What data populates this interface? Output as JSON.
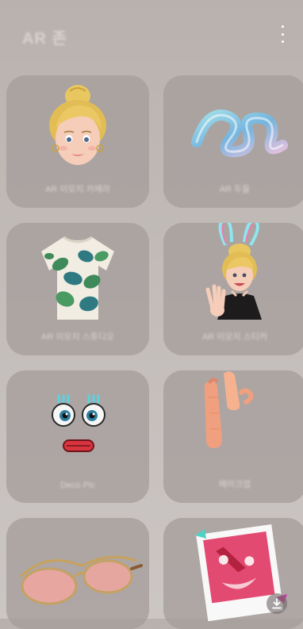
{
  "header": {
    "title": "AR 존",
    "menu_icon": "more-vertical-icon"
  },
  "cards": [
    {
      "id": "ar-emoji-camera",
      "label": "AR 이모지 카메라",
      "icon": "avatar-face"
    },
    {
      "id": "ar-doodle",
      "label": "AR 두들",
      "icon": "neon-scribble"
    },
    {
      "id": "ar-emoji-studio",
      "label": "AR 이모지 스튜디오",
      "icon": "tropical-shirt"
    },
    {
      "id": "ar-emoji-stickers",
      "label": "AR 이모지 스티커",
      "icon": "avatar-waving"
    },
    {
      "id": "deco-pic",
      "label": "Deco Pic",
      "icon": "cartoon-eyes"
    },
    {
      "id": "makeup",
      "label": "메이크업",
      "icon": "makeup-swatches"
    },
    {
      "id": "sunglasses",
      "label": "",
      "icon": "sunglasses"
    },
    {
      "id": "photo-frame",
      "label": "",
      "icon": "polaroid-photo"
    }
  ],
  "download_icon": "download-icon"
}
